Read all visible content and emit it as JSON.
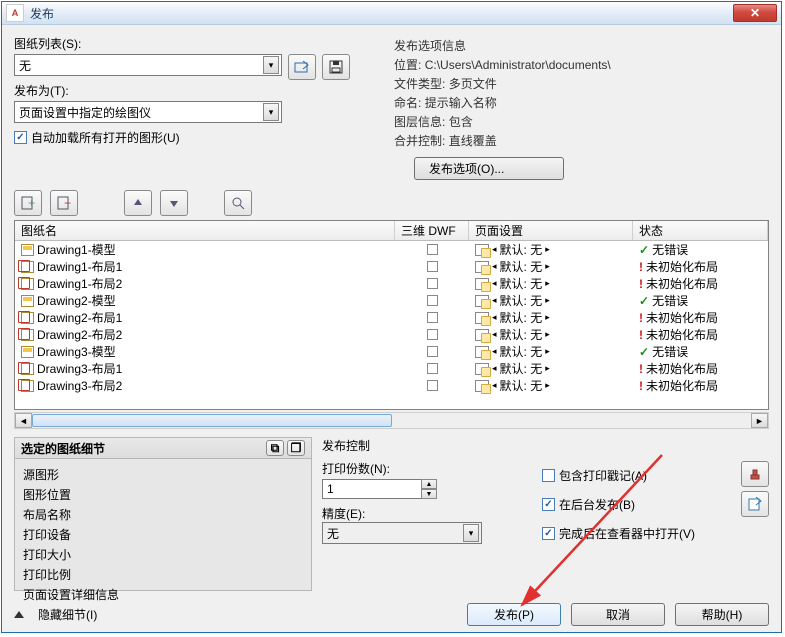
{
  "window": {
    "title": "发布",
    "app_icon": "A"
  },
  "left": {
    "sheet_list_label": "图纸列表(S):",
    "sheet_list_value": "无",
    "publish_as_label": "发布为(T):",
    "publish_as_value": "页面设置中指定的绘图仪",
    "autoload_label": "自动加载所有打开的图形(U)"
  },
  "info": {
    "heading": "发布选项信息",
    "location_label": "位置:",
    "location_value": "C:\\Users\\Administrator\\documents\\",
    "filetype_label": "文件类型:",
    "filetype_value": "多页文件",
    "naming_label": "命名:",
    "naming_value": "提示输入名称",
    "layer_label": "图层信息:",
    "layer_value": "包含",
    "merge_label": "合并控制:",
    "merge_value": "直线覆盖",
    "options_btn": "发布选项(O)..."
  },
  "grid": {
    "headers": {
      "name": "图纸名",
      "dwf": "三维 DWF",
      "page": "页面设置",
      "status": "状态"
    },
    "page_default": "默认: 无",
    "status_ok": "无错误",
    "status_err": "未初始化布局",
    "rows": [
      {
        "name": "Drawing1-模型",
        "type": "model",
        "status": "ok"
      },
      {
        "name": "Drawing1-布局1",
        "type": "layout",
        "status": "err"
      },
      {
        "name": "Drawing1-布局2",
        "type": "layout",
        "status": "err"
      },
      {
        "name": "Drawing2-模型",
        "type": "model",
        "status": "ok"
      },
      {
        "name": "Drawing2-布局1",
        "type": "layout",
        "status": "err"
      },
      {
        "name": "Drawing2-布局2",
        "type": "layout",
        "status": "err"
      },
      {
        "name": "Drawing3-模型",
        "type": "model",
        "status": "ok"
      },
      {
        "name": "Drawing3-布局1",
        "type": "layout",
        "status": "err"
      },
      {
        "name": "Drawing3-布局2",
        "type": "layout",
        "status": "err"
      }
    ]
  },
  "details": {
    "heading": "选定的图纸细节",
    "items": [
      "源图形",
      "图形位置",
      "布局名称",
      "打印设备",
      "打印大小",
      "打印比例",
      "页面设置详细信息"
    ]
  },
  "publish_ctrl": {
    "heading": "发布控制",
    "copies_label": "打印份数(N):",
    "copies_value": "1",
    "precision_label": "精度(E):",
    "precision_value": "无",
    "include_stamp": "包含打印戳记(A)",
    "background": "在后台发布(B)",
    "open_viewer": "完成后在查看器中打开(V)"
  },
  "footer": {
    "hide_details": "隐藏细节(I)",
    "publish": "发布(P)",
    "cancel": "取消",
    "help": "帮助(H)"
  },
  "glyph": {
    "check": "✓",
    "left": "◄",
    "right": "►",
    "down": "▾",
    "prev": "⧉",
    "x": "✕",
    "bang": "!"
  }
}
